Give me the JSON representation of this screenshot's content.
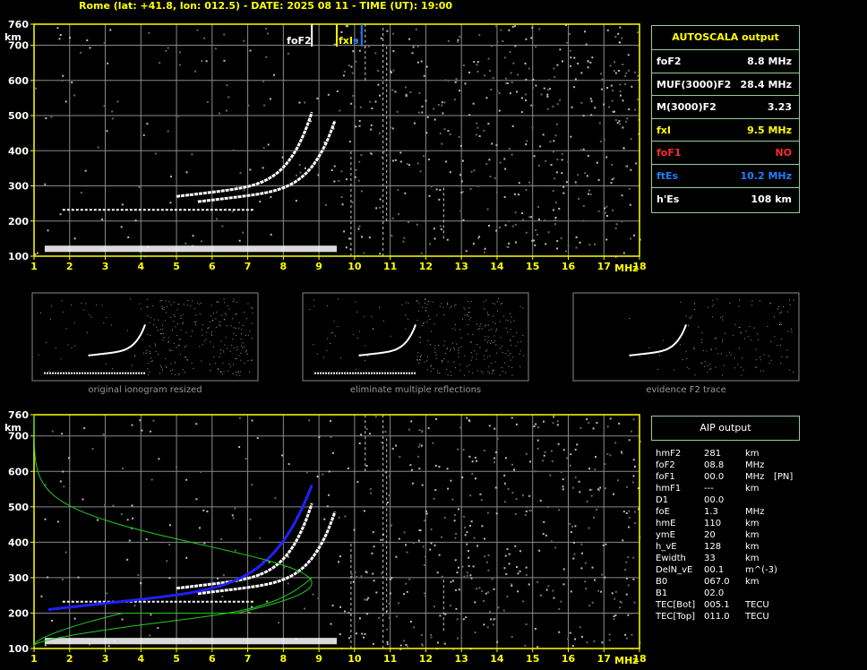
{
  "header": {
    "title": "Rome (lat: +41.8, lon: 012.5) - DATE: 2025 08 11 - TIME (UT): 19:00"
  },
  "colors": {
    "axis": "#ffff00",
    "grid": "#8a8a8a",
    "panel_border": "#99cc99",
    "fxi": "#ffff00",
    "fof1": "#ff2a2a",
    "ftes": "#1e7fff",
    "fit": "#2020ff",
    "profile": "#22cc22"
  },
  "main_ionogram": {
    "y_unit": "km",
    "x_unit": "MHz",
    "y_ticks": [
      "760",
      "700",
      "600",
      "500",
      "400",
      "300",
      "200",
      "100"
    ],
    "x_ticks": [
      "1",
      "2",
      "3",
      "4",
      "5",
      "6",
      "7",
      "8",
      "9",
      "10",
      "11",
      "12",
      "13",
      "14",
      "15",
      "16",
      "17",
      "18"
    ],
    "markers": {
      "foF2": "foF2",
      "fxI": "fxI",
      "fbEs": "s"
    }
  },
  "autoscala": {
    "title": "AUTOSCALA output",
    "rows": [
      {
        "label": "foF2",
        "value": "8.8 MHz",
        "color": "#ffffff"
      },
      {
        "label": "MUF(3000)F2",
        "value": "28.4 MHz",
        "color": "#ffffff"
      },
      {
        "label": "M(3000)F2",
        "value": "3.23",
        "color": "#ffffff"
      },
      {
        "label": "fxI",
        "value": "9.5 MHz",
        "color": "#ffff00"
      },
      {
        "label": "foF1",
        "value": "NO",
        "color": "#ff2a2a"
      },
      {
        "label": "ftEs",
        "value": "10.2 MHz",
        "color": "#1e7fff"
      },
      {
        "label": "h'Es",
        "value": "108    km",
        "color": "#ffffff"
      }
    ]
  },
  "thumbnails": [
    {
      "caption": "original ionogram resized"
    },
    {
      "caption": "eliminate multiple reflections"
    },
    {
      "caption": "evidence F2 trace"
    }
  ],
  "aip": {
    "title": "AIP output",
    "rows": [
      {
        "name": "hmF2",
        "value": "281",
        "unit": "km",
        "extra": ""
      },
      {
        "name": "foF2",
        "value": "08.8",
        "unit": "MHz",
        "extra": ""
      },
      {
        "name": "foF1",
        "value": "00.0",
        "unit": "MHz",
        "extra": "[PN]"
      },
      {
        "name": "hmF1",
        "value": "---",
        "unit": "km",
        "extra": ""
      },
      {
        "name": "D1",
        "value": "00.0",
        "unit": "",
        "extra": ""
      },
      {
        "name": "foE",
        "value": "1.3",
        "unit": "MHz",
        "extra": ""
      },
      {
        "name": "hmE",
        "value": "110",
        "unit": "km",
        "extra": ""
      },
      {
        "name": "ymE",
        "value": "20",
        "unit": "km",
        "extra": ""
      },
      {
        "name": "h_vE",
        "value": "128",
        "unit": "km",
        "extra": ""
      },
      {
        "name": "Ewidth",
        "value": "33",
        "unit": "km",
        "extra": ""
      },
      {
        "name": "DelN_vE",
        "value": "00.1",
        "unit": "m^(-3)",
        "extra": ""
      },
      {
        "name": "B0",
        "value": "067.0",
        "unit": "km",
        "extra": ""
      },
      {
        "name": "B1",
        "value": "02.0",
        "unit": "",
        "extra": ""
      },
      {
        "name": "TEC[Bot]",
        "value": "005.1",
        "unit": "TECU",
        "extra": ""
      },
      {
        "name": "TEC[Top]",
        "value": "011.0",
        "unit": "TECU",
        "extra": ""
      }
    ]
  }
}
